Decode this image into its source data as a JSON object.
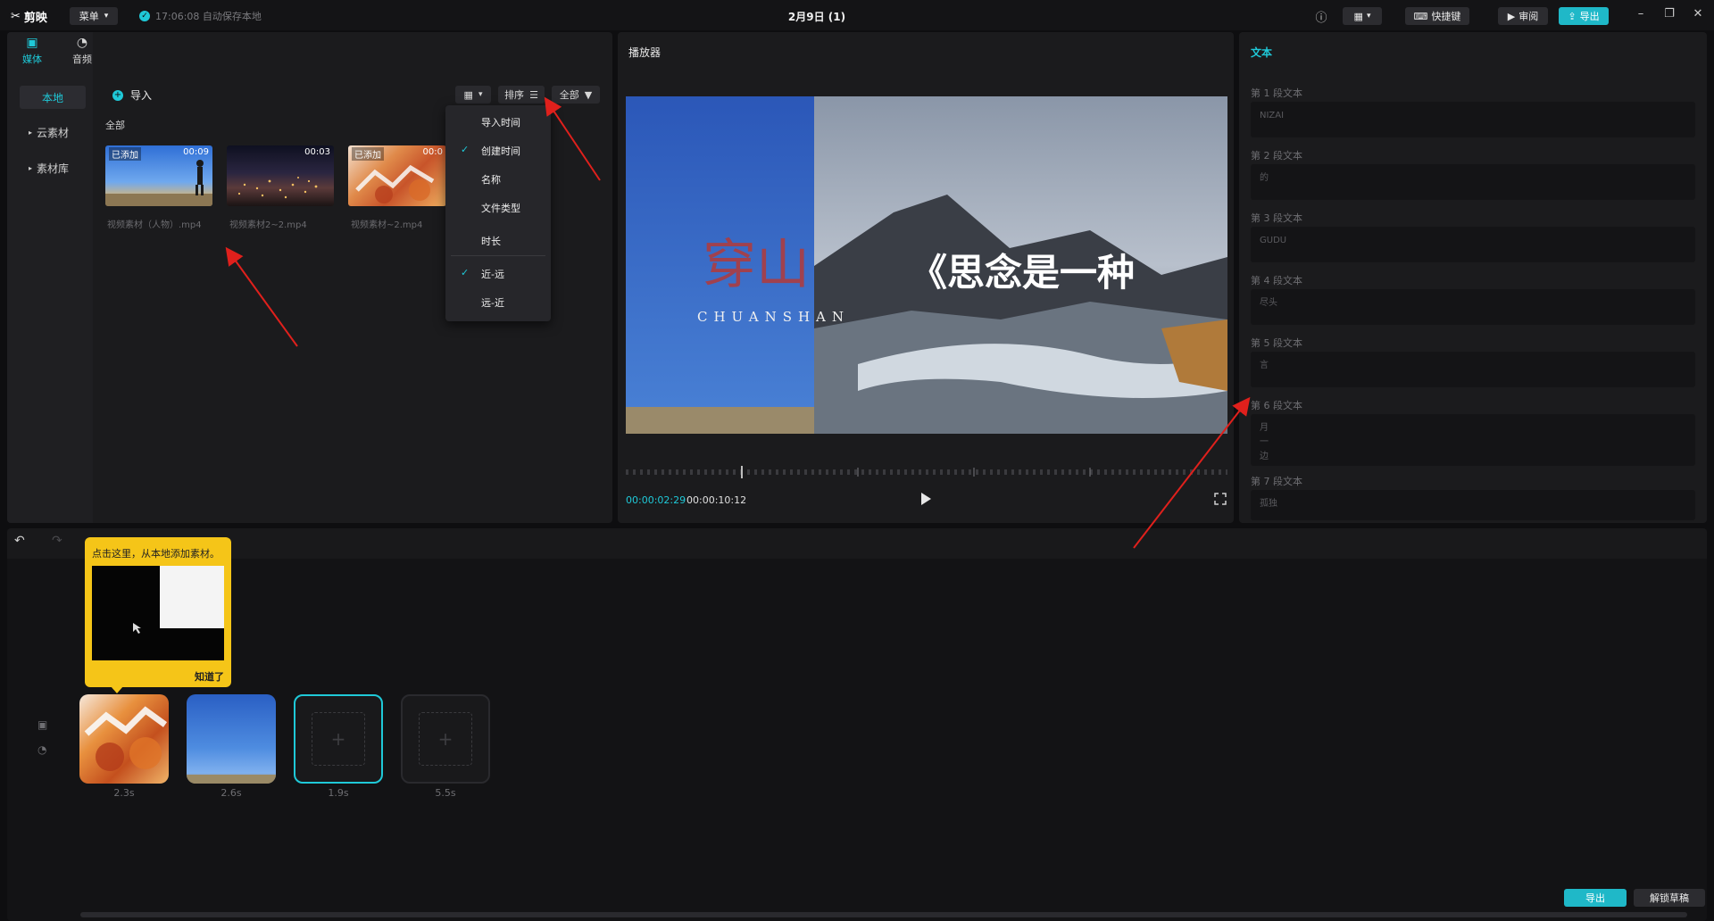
{
  "app": {
    "name": "剪映",
    "menu_label": "菜单",
    "autosave": "17:06:08 自动保存本地",
    "doc_title": "2月9日 (1)",
    "shortcuts_label": "快捷键",
    "review_label": "审阅",
    "export_label": "导出"
  },
  "media": {
    "tabs": [
      {
        "label": "媒体",
        "icon": "media-icon"
      },
      {
        "label": "音频",
        "icon": "audio-icon"
      }
    ],
    "sidebar": [
      "本地",
      "云素材",
      "素材库"
    ],
    "import_label": "导入",
    "all_label": "全部",
    "sort_label": "排序",
    "filter_label": "全部",
    "items": [
      {
        "name": "视频素材（人物）.mp4",
        "duration": "00:09",
        "tag": "已添加"
      },
      {
        "name": "视频素材2~2.mp4",
        "duration": "00:03",
        "tag": ""
      },
      {
        "name": "视频素材~2.mp4",
        "duration": "00:0",
        "tag": "已添加"
      }
    ]
  },
  "sort_menu": {
    "items": [
      "导入时间",
      "创建时间",
      "名称",
      "文件类型",
      "时长"
    ],
    "checked": "创建时间",
    "order": [
      "近-远",
      "远-近"
    ],
    "order_checked": "近-远"
  },
  "player": {
    "title": "播放器",
    "current_time": "00:00:02:29",
    "total_time": "00:00:10:12",
    "overlay_title": "穿山",
    "overlay_sub": "CHUANSHAN",
    "overlay_quote": "《思念是一种"
  },
  "text_panel": {
    "title": "文本",
    "paragraphs": [
      {
        "label": "第 1 段文本",
        "value": "NIZAI"
      },
      {
        "label": "第 2 段文本",
        "value": "的"
      },
      {
        "label": "第 3 段文本",
        "value": "GUDU"
      },
      {
        "label": "第 4 段文本",
        "value": "尽头"
      },
      {
        "label": "第 5 段文本",
        "value": "言"
      },
      {
        "label": "第 6 段文本",
        "value": "月\n一\n边"
      },
      {
        "label": "第 7 段文本",
        "value": "孤独"
      }
    ]
  },
  "timeline": {
    "tooltip_text": "点击这里，从本地添加素材。",
    "tooltip_ok": "知道了",
    "clips": [
      {
        "duration": "2.3s",
        "kind": "autumn"
      },
      {
        "duration": "2.6s",
        "kind": "sky"
      },
      {
        "duration": "1.9s",
        "kind": "empty-selected"
      },
      {
        "duration": "5.5s",
        "kind": "empty"
      }
    ],
    "export_label": "导出",
    "draft_label": "解锁草稿"
  },
  "colors": {
    "accent": "#1fc9d8",
    "annotation": "#e0201c",
    "tooltip": "#f5c518"
  }
}
